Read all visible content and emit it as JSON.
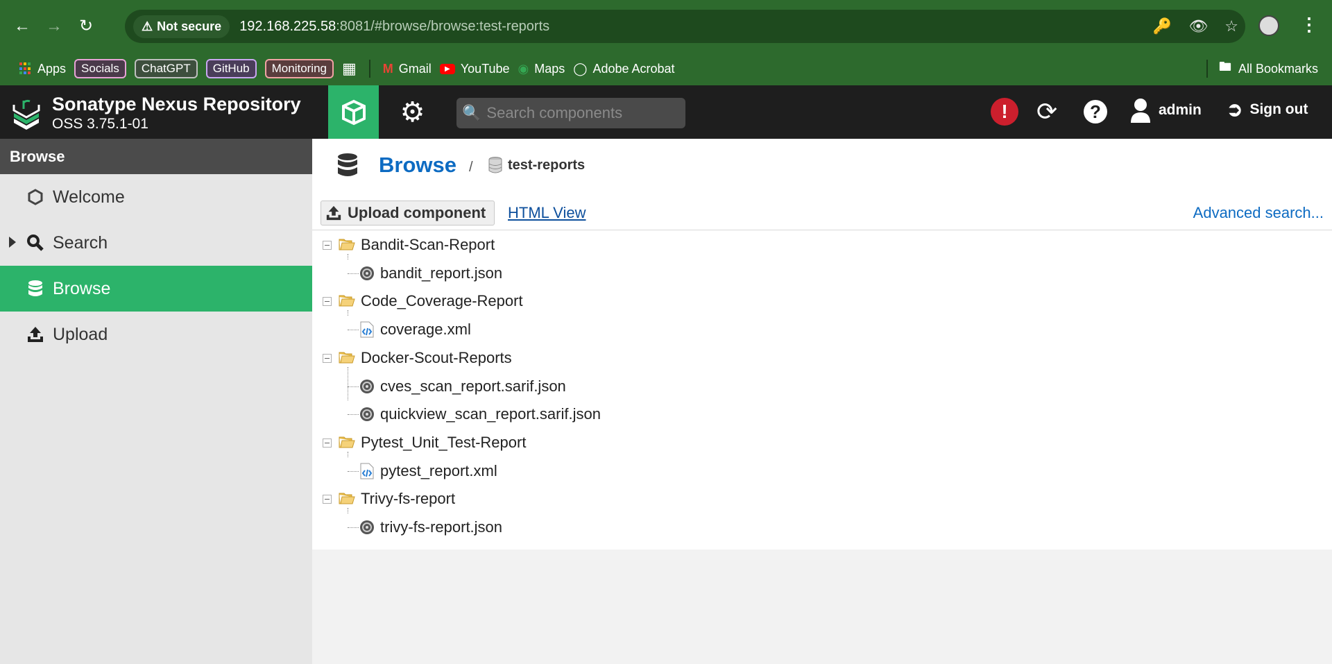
{
  "browser": {
    "security_label": "Not secure",
    "url_host": "192.168.225.58",
    "url_rest": ":8081/#browse/browse:test-reports",
    "bookmarks": [
      {
        "label": "Apps"
      },
      {
        "label": "Socials",
        "color": "#e7a3d6"
      },
      {
        "label": "ChatGPT",
        "color": "#bfbfbf"
      },
      {
        "label": "GitHub",
        "color": "#c9a6f0"
      },
      {
        "label": "Monitoring",
        "color": "#f0a3a3"
      },
      {
        "label": "Gmail"
      },
      {
        "label": "YouTube"
      },
      {
        "label": "Maps"
      },
      {
        "label": "Adobe Acrobat"
      }
    ],
    "all_bookmarks": "All Bookmarks"
  },
  "nexus": {
    "title": "Sonatype Nexus Repository",
    "version": "OSS 3.75.1-01",
    "search_placeholder": "Search components",
    "user": "admin",
    "signout": "Sign out",
    "accent_color": "#2cb36a"
  },
  "sidebar": {
    "header": "Browse",
    "items": [
      {
        "label": "Welcome",
        "icon": "hexagon-icon"
      },
      {
        "label": "Search",
        "icon": "search-icon"
      },
      {
        "label": "Browse",
        "icon": "database-icon",
        "active": true
      },
      {
        "label": "Upload",
        "icon": "upload-icon"
      }
    ]
  },
  "main": {
    "breadcrumb_title": "Browse",
    "breadcrumb_sep": "/",
    "repository": "test-reports",
    "upload_button": "Upload component",
    "html_view": "HTML View",
    "advanced_search": "Advanced search..."
  },
  "tree": [
    {
      "folder": "Bandit-Scan-Report",
      "files": [
        {
          "name": "bandit_report.json",
          "type": "json"
        }
      ]
    },
    {
      "folder": "Code_Coverage-Report",
      "files": [
        {
          "name": "coverage.xml",
          "type": "xml"
        }
      ]
    },
    {
      "folder": "Docker-Scout-Reports",
      "files": [
        {
          "name": "cves_scan_report.sarif.json",
          "type": "json"
        },
        {
          "name": "quickview_scan_report.sarif.json",
          "type": "json"
        }
      ]
    },
    {
      "folder": "Pytest_Unit_Test-Report",
      "files": [
        {
          "name": "pytest_report.xml",
          "type": "xml"
        }
      ]
    },
    {
      "folder": "Trivy-fs-report",
      "files": [
        {
          "name": "trivy-fs-report.json",
          "type": "json"
        }
      ]
    }
  ]
}
